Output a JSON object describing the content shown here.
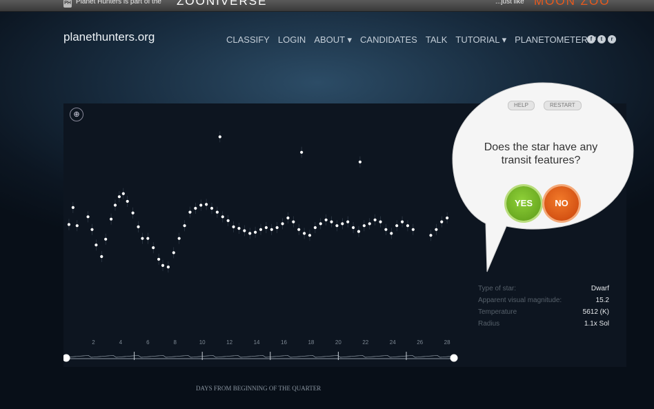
{
  "topbar": {
    "logo_text": "PH",
    "part_of": "Planet Hunters is part of the",
    "zooniverse": "ZOONIVERSE",
    "just_like": "...just like",
    "moon_zoo": "MOON ZOO"
  },
  "brand": "planethunters.org",
  "nav": [
    "CLASSIFY",
    "LOGIN",
    "ABOUT ▾",
    "CANDIDATES",
    "TALK",
    "TUTORIAL ▾",
    "PLANETOMETER™ ▾"
  ],
  "social_icons": [
    "facebook-icon",
    "twitter-icon",
    "rss-icon"
  ],
  "classify": {
    "help": "HELP",
    "restart": "RESTART",
    "question": "Does the star have any transit features?",
    "yes": "YES",
    "no": "NO"
  },
  "star_info": [
    {
      "label": "Type of star:",
      "value": "Dwarf"
    },
    {
      "label": "Apparent visual magnitude:",
      "value": "15.2"
    },
    {
      "label": "Temperature",
      "value": "5612 (K)"
    },
    {
      "label": "Radius",
      "value": "1.1x Sol"
    }
  ],
  "colors": {
    "yes": "#6fb223",
    "no": "#e05a12",
    "points": "#ffffff"
  },
  "chart_data": {
    "type": "scatter",
    "title": "",
    "xlabel": "DAYS FROM BEGINNING OF THE QUARTER",
    "ylabel": "",
    "xlim": [
      0,
      28.5
    ],
    "ylim": [
      0.9974,
      1.0024
    ],
    "yticks": [
      "1.002",
      "1.001",
      "1.000",
      "0.999",
      "0.998"
    ],
    "xticks_top": [
      "2",
      "4",
      "6",
      "8",
      "10",
      "12",
      "14",
      "16",
      "18",
      "20",
      "22",
      "24",
      "26",
      "28"
    ],
    "xticks_bottom": [
      "5",
      "10",
      "15",
      "20",
      "25"
    ],
    "series": [
      {
        "x": [
          0.2,
          0.5,
          0.8,
          1.6,
          1.9,
          2.2,
          2.6,
          2.9,
          3.3,
          3.6,
          3.9,
          4.2,
          4.5,
          4.9,
          5.3,
          5.6,
          6.0,
          6.4,
          6.8,
          7.1,
          7.5,
          7.9,
          8.3,
          8.7,
          9.1,
          9.5,
          9.9,
          10.3,
          10.7,
          11.1,
          11.5,
          11.9,
          12.3,
          12.7,
          13.1,
          13.5,
          13.9,
          14.3,
          14.7,
          15.1,
          15.5,
          15.9,
          16.3,
          16.7,
          17.1,
          17.5,
          17.9,
          18.3,
          18.7,
          19.1,
          19.5,
          19.9,
          20.3,
          20.7,
          21.1,
          21.5,
          21.9,
          22.3,
          22.7,
          23.1,
          23.5,
          23.9,
          24.3,
          24.7,
          25.1,
          25.5,
          26.8,
          27.2,
          27.6,
          28.0,
          11.3,
          17.3,
          21.6
        ],
        "y": [
          0.99998,
          1.00042,
          0.99995,
          1.00018,
          0.99985,
          0.99945,
          0.99915,
          0.9996,
          1.00012,
          1.00048,
          1.0007,
          1.00078,
          1.00058,
          1.00028,
          0.99992,
          0.99962,
          0.99962,
          0.99938,
          0.99908,
          0.99892,
          0.99888,
          0.99925,
          0.99962,
          0.99995,
          1.0003,
          1.0004,
          1.00048,
          1.0005,
          1.0004,
          1.0003,
          1.00018,
          1.00008,
          0.99992,
          0.99988,
          0.99982,
          0.99975,
          0.99978,
          0.99985,
          0.9999,
          0.99985,
          0.9999,
          1.0,
          1.00015,
          1.00005,
          0.99985,
          0.99975,
          0.9997,
          0.9999,
          1.0,
          1.0001,
          1.00005,
          0.99995,
          1.0,
          1.00005,
          0.9999,
          0.9998,
          0.99995,
          1.0,
          1.0001,
          1.00005,
          0.99985,
          0.99975,
          0.99995,
          1.00005,
          0.99995,
          0.99985,
          0.9997,
          0.99985,
          1.00005,
          1.00015,
          1.00225,
          1.00185,
          1.0016
        ]
      }
    ]
  }
}
